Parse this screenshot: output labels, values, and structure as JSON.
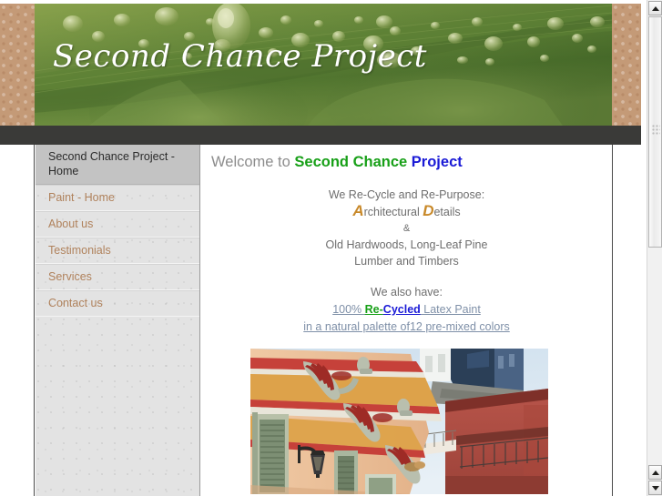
{
  "banner": {
    "title": "Second Chance Project",
    "background_color": "#6b8f3d",
    "margin_pattern_color": "#c49a77",
    "separator_color": "#3a3a38"
  },
  "sidebar": {
    "items": [
      {
        "label": "Second Chance Project - Home",
        "active": true
      },
      {
        "label": "Paint - Home",
        "active": false
      },
      {
        "label": "About us",
        "active": false
      },
      {
        "label": "Testimonials",
        "active": false
      },
      {
        "label": "Services",
        "active": false
      },
      {
        "label": "Contact us",
        "active": false
      }
    ],
    "link_color": "#b0825c",
    "active_bg": "#c3c3c3"
  },
  "content": {
    "welcome": {
      "prefix": "Welcome to ",
      "green": "Second Chance",
      "space": " ",
      "blue": "Project",
      "prefix_color": "#8c8c8c",
      "green_color": "#18a018",
      "blue_color": "#1a1ad6"
    },
    "intro": {
      "line1": "We Re-Cycle and Re-Purpose:",
      "line2_cap1": "A",
      "line2_rest1": "rchitectural ",
      "line2_cap2": "D",
      "line2_rest2": "etails",
      "line3": "&",
      "line4": "Old Hardwoods, Long-Leaf Pine",
      "line5": "Lumber and Timbers",
      "cap_color": "#c8892a"
    },
    "also": {
      "heading": "We also have:",
      "link1_part1": "100% ",
      "link1_green": "Re-",
      "link1_blue": "Cycled",
      "link1_part2": " Latex Paint",
      "link2": "in a natural palette of12 pre-mixed colors",
      "link_color": "#7f90a8"
    },
    "photo": {
      "alt": "New Orleans style building facade with decorative brackets, balconies and a lamp"
    }
  },
  "scrollbar": {
    "up_arrow": "▲",
    "down_arrow": "▼"
  }
}
